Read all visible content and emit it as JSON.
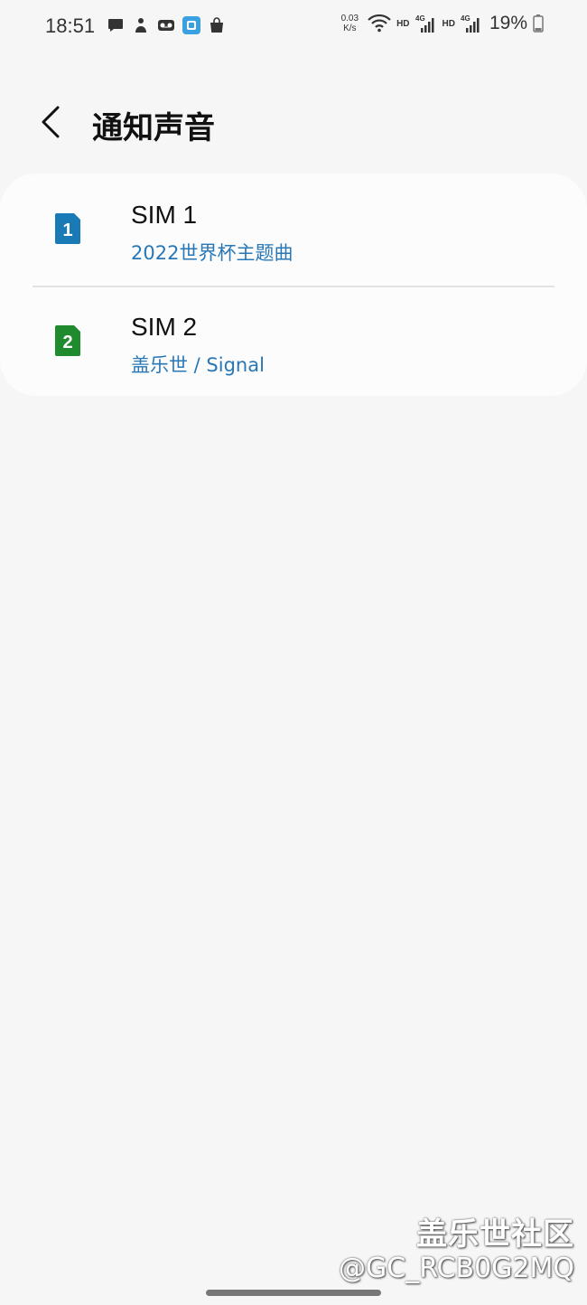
{
  "status_bar": {
    "time": "18:51",
    "netspeed_value": "0.03",
    "netspeed_unit": "K/s",
    "hd1": "HD",
    "hd2": "HD",
    "battery": "19%",
    "notification_icons": [
      "message-icon",
      "person-icon",
      "voicemail-icon",
      "app-icon",
      "shopping-bag-icon"
    ],
    "status_icons": [
      "wifi-icon",
      "signal-4g-icon",
      "signal-4g-icon",
      "battery-icon"
    ]
  },
  "header": {
    "title": "通知声音"
  },
  "sim_list": [
    {
      "badge": "1",
      "badge_color": "#1a7ab6",
      "title": "SIM 1",
      "subtitle": "2022世界杯主题曲"
    },
    {
      "badge": "2",
      "badge_color": "#1f8a2e",
      "title": "SIM 2",
      "subtitle": "盖乐世 / Signal"
    }
  ],
  "watermark": {
    "line1": "盖乐世社区",
    "line2": "@GC_RCB0G2MQ"
  },
  "colors": {
    "background": "#f6f6f6",
    "card": "#fcfcfc",
    "subtitle": "#2877b6"
  }
}
